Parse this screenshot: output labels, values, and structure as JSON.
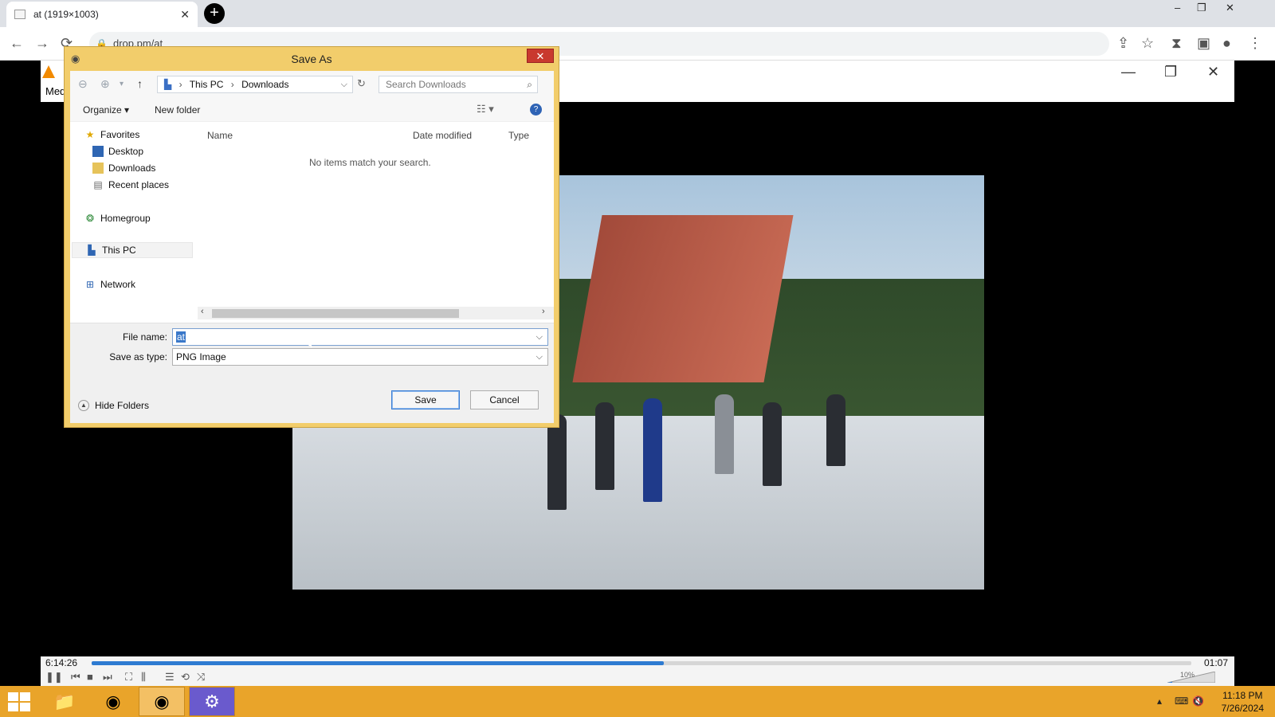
{
  "browser": {
    "tab_title": "at (1919×1003)",
    "tab_close": "✕",
    "new_tab": "+",
    "url": "drop.pm/at",
    "window_controls": [
      "–",
      "❐",
      "✕"
    ],
    "toolbar_icons": [
      "←",
      "→",
      "⟳",
      "⇪",
      "☆",
      "⧗",
      "▣",
      "●",
      "⋮"
    ]
  },
  "vlc": {
    "menu_label": "Med",
    "window_controls": [
      "—",
      "❐",
      "✕"
    ],
    "elapsed": "6:14:26",
    "remaining": "01:07",
    "progress_percent": 52,
    "control_icons": [
      "❚❚",
      "⏮",
      "■",
      "⏭",
      "⛶",
      "⫼",
      "☰",
      "⟲",
      "⤨"
    ],
    "volume_label": "10%"
  },
  "dialog": {
    "title": "Save As",
    "close": "✕",
    "breadcrumb": [
      "This PC",
      "Downloads"
    ],
    "search_placeholder": "Search Downloads",
    "organize": "Organize ▾",
    "new_folder": "New folder",
    "help": "?",
    "nav": {
      "favorites": "Favorites",
      "desktop": "Desktop",
      "downloads": "Downloads",
      "recent": "Recent places",
      "homegroup": "Homegroup",
      "this_pc": "This PC",
      "network": "Network"
    },
    "columns": {
      "name": "Name",
      "date_modified": "Date modified",
      "type": "Type"
    },
    "empty_message": "No items match your search.",
    "file_name_label": "File name:",
    "file_name_value": "at",
    "save_as_type_label": "Save as type:",
    "save_as_type_value": "PNG Image",
    "hide_folders": "Hide Folders",
    "save_button": "Save",
    "cancel_button": "Cancel"
  },
  "taskbar": {
    "time": "11:18 PM",
    "date": "7/26/2024",
    "tray_icons": [
      "▴",
      "⌨",
      "🔇"
    ]
  },
  "colors": {
    "taskbar": "#e9a42a",
    "dialog_frame": "#f2cd6b",
    "close_red": "#c9392e",
    "vlc_progress": "#2e7bd1"
  }
}
